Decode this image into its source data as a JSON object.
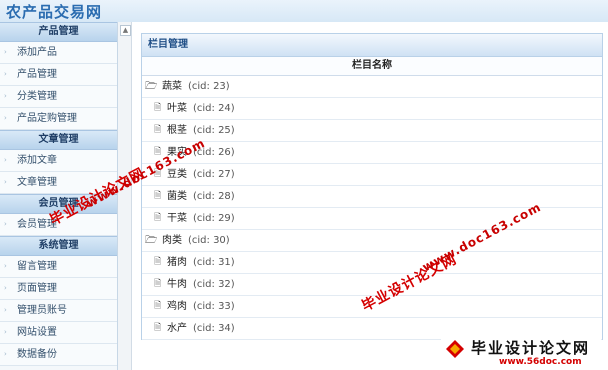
{
  "app_title": "农产品交易网",
  "sidebar": {
    "sections": [
      {
        "header": "产品管理",
        "items": [
          "添加产品",
          "产品管理",
          "分类管理",
          "产品定购管理"
        ]
      },
      {
        "header": "文章管理",
        "items": [
          "添加文章",
          "文章管理"
        ]
      },
      {
        "header": "会员管理",
        "items": [
          "会员管理"
        ]
      },
      {
        "header": "系统管理",
        "items": [
          "留言管理",
          "页面管理",
          "管理员账号",
          "网站设置",
          "数据备份"
        ]
      }
    ]
  },
  "panel": {
    "title": "栏目管理",
    "column_header": "栏目名称",
    "rows": [
      {
        "kind": "parent",
        "name": "蔬菜",
        "cid": "(cid: 23)"
      },
      {
        "kind": "child",
        "name": "叶菜",
        "cid": "(cid: 24)"
      },
      {
        "kind": "child",
        "name": "根茎",
        "cid": "(cid: 25)"
      },
      {
        "kind": "child",
        "name": "果实",
        "cid": "(cid: 26)"
      },
      {
        "kind": "child",
        "name": "豆类",
        "cid": "(cid: 27)"
      },
      {
        "kind": "child",
        "name": "菌类",
        "cid": "(cid: 28)"
      },
      {
        "kind": "child",
        "name": "干菜",
        "cid": "(cid: 29)"
      },
      {
        "kind": "parent",
        "name": "肉类",
        "cid": "(cid: 30)"
      },
      {
        "kind": "child",
        "name": "猪肉",
        "cid": "(cid: 31)"
      },
      {
        "kind": "child",
        "name": "牛肉",
        "cid": "(cid: 32)"
      },
      {
        "kind": "child",
        "name": "鸡肉",
        "cid": "(cid: 33)"
      },
      {
        "kind": "child",
        "name": "水产",
        "cid": "(cid: 34)"
      }
    ]
  },
  "watermarks": {
    "brand": "毕业设计论文网",
    "url": "www.doc163.com",
    "logo_text": "毕业设计论文网",
    "logo_url": "www.56doc.com"
  },
  "icons": {
    "folder": "folder-icon",
    "document": "document-icon",
    "scroll_up": "scroll-up-arrow-icon"
  },
  "colors": {
    "accent": "#2a6cb0",
    "watermark": "#d40000"
  }
}
